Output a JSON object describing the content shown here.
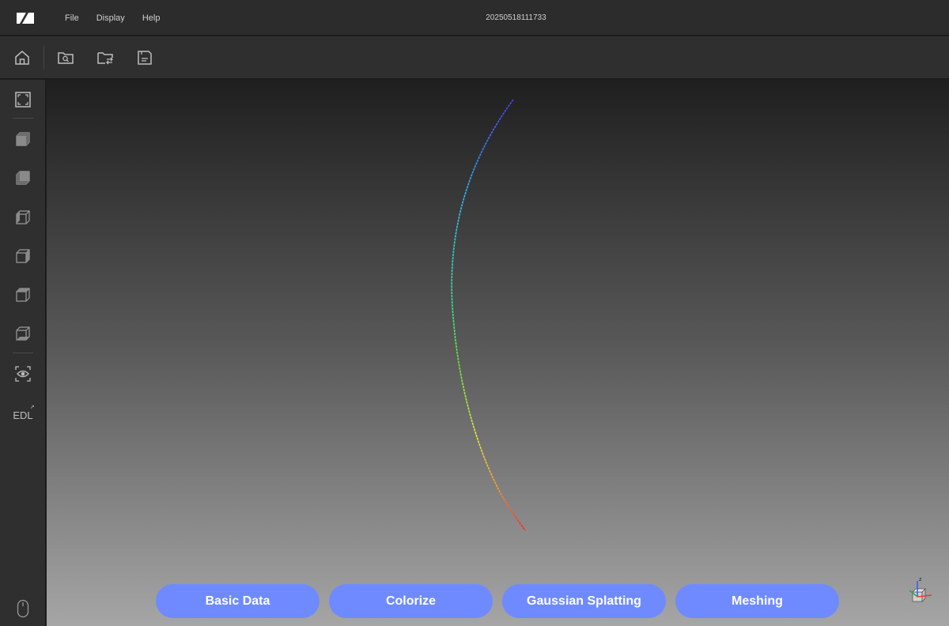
{
  "titlebar": {
    "menu": [
      {
        "key": "file",
        "label": "File"
      },
      {
        "key": "display",
        "label": "Display"
      },
      {
        "key": "help",
        "label": "Help"
      }
    ],
    "window_title": "20250518111733"
  },
  "toolbar": {
    "icons": [
      "home-icon",
      "folder-search-icon",
      "folder-swap-icon",
      "save-icon"
    ]
  },
  "sidebar": {
    "icons": [
      "fit-view-icon",
      "view-cube-front-icon",
      "view-cube-back-icon",
      "view-cube-left-icon",
      "view-cube-right-icon",
      "view-cube-top-icon",
      "view-cube-bottom-icon",
      "eye-focus-icon",
      "edl-icon",
      "mouse-icon"
    ],
    "edl_label": "EDL"
  },
  "tabs": [
    {
      "label": "Basic Data"
    },
    {
      "label": "Colorize"
    },
    {
      "label": "Gaussian Splatting"
    },
    {
      "label": "Meshing"
    }
  ],
  "gizmo": {
    "z_label": "z"
  },
  "colors": {
    "accent": "#6f8aff",
    "panel": "#2f2f2f",
    "curve_gradient": [
      "#3a3aff",
      "#2fd0ff",
      "#2fe07a",
      "#e8f03a",
      "#ff2020"
    ]
  }
}
